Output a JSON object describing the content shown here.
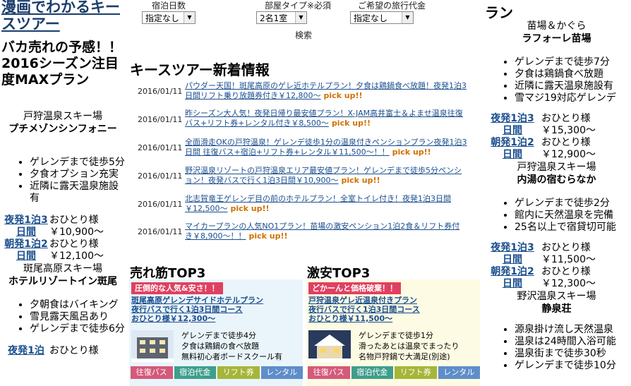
{
  "left": {
    "site_title": "漫画でわかるキースツアー",
    "feature_title": "バカ売れの予感！！2016シーズン注目度MAXプラン",
    "hotels": [
      {
        "area": "戸狩温泉スキー場",
        "name": "プチメゾンシンフォニー",
        "features": [
          "ゲレンデまで徒歩5分",
          "夕食オプション充実",
          "近隣に露天温泉施設有"
        ],
        "prices": [
          {
            "plan": "夜発1泊3日間",
            "who": "おひとり様",
            "amount": "￥10,900～"
          },
          {
            "plan": "朝発1泊2日間",
            "who": "おひとり様",
            "amount": "￥12,100～"
          }
        ]
      },
      {
        "area": "斑尾高原スキー場",
        "name": "ホテルリゾートイン斑尾",
        "features": [
          "夕朝食はバイキング",
          "雪見露天風呂あり",
          "ゲレンデまで徒歩6分"
        ],
        "prices": [
          {
            "plan": "夜発1泊",
            "who": "おひとり様",
            "amount": ""
          }
        ]
      }
    ]
  },
  "search": {
    "nights_label": "宿泊日数",
    "nights_value": "指定なし",
    "room_label": "部屋タイプ※必須",
    "room_value": "2名1室",
    "budget_label": "ご希望の旅行代金",
    "budget_value": "指定なし",
    "button": "検索"
  },
  "news": {
    "title": "キースツアー新着情報",
    "pick_label": "pick up!!",
    "items": [
      {
        "date": "2016/01/11",
        "text": "パウダー天国！斑尾高原のゲレ近ホテルプラン！夕食は鶏鍋食べ放題！夜発1泊3日間リフト乗り放題券付き￥12,800～"
      },
      {
        "date": "2016/01/11",
        "text": "昨シーズン大人気！夜発日帰り最安値プラン！X-JAM高井富士＆よませ温泉往復バス+リフト券+レンタル付き￥8,500～"
      },
      {
        "date": "2016/01/11",
        "text": "全面滑走OKの戸狩温泉！ゲレンデ徒歩1分の温泉付きペンションプラン夜発1泊3日間 往復バス+宿泊+リフト券+レンタル￥11,500～！！"
      },
      {
        "date": "2016/01/11",
        "text": "野沢温泉リゾートの戸狩温泉エリア最安値プラン！ゲレンデまで徒歩5分ペンション！夜発バスで行く1泊3日間￥10,900～"
      },
      {
        "date": "2016/01/11",
        "text": "北志賀竜王ゲレンデ目の前のホテルプラン！全室トイレ付き！夜発1泊3日間￥12,500～"
      },
      {
        "date": "2016/01/11",
        "text": "マイカープランの人気NO1プラン！苗場の激安ペンション1泊2食＆リフト券付き￥8,900～！！"
      }
    ]
  },
  "best": {
    "title": "売れ筋TOP3",
    "ribbon": "圧倒的な人気&安さ！！",
    "plan_lines": [
      "斑尾高原ゲレンデサイドホテルプラン",
      "夜行バスで行く1泊3日間コース",
      "おひとり様￥12,300～"
    ],
    "features": [
      "ゲレンデまで徒歩4分",
      "夕食は鶏鍋の食べ放題",
      "無料初心者ボードスクール有"
    ],
    "tags": [
      "往復バス",
      "宿泊代金",
      "リフト券",
      "レンタル"
    ]
  },
  "cheap": {
    "title": "激安TOP3",
    "ribbon": "どかーんと価格破棄！！",
    "plan_lines": [
      "戸狩温泉ゲレ近温泉付きプラン",
      "夜行バスで行く1泊3日間コース",
      "おひとり様￥11,500～"
    ],
    "features": [
      "ゲレンデまで徒歩1分",
      "滑ったあとは温泉でまったり",
      "名物戸狩鍋で大満足(別途)"
    ],
    "tags": [
      "往復バス",
      "宿泊代金",
      "リフト券",
      "レンタル"
    ]
  },
  "right": {
    "top_fragment": "ラン",
    "hotels": [
      {
        "area": "苗場＆かぐら",
        "name": "ラフォーレ苗場",
        "features": [
          "ゲレンデまで徒歩7分",
          "夕食は鶏鍋食べ放題",
          "近隣に露天温泉施設有",
          "雪マジ19対応ゲレンデ"
        ],
        "prices": [
          {
            "plan": "夜発1泊3日間",
            "who": "おひとり様",
            "amount": "￥15,300～"
          },
          {
            "plan": "朝発1泊2日間",
            "who": "おひとり様",
            "amount": "￥12,900～"
          }
        ]
      },
      {
        "area": "戸狩温泉スキー場",
        "name": "内湯の宿むらなか",
        "features": [
          "ゲレンデまで徒歩2分",
          "館内に天然温泉を完備",
          "25名以上で宿貸切可能"
        ],
        "prices": [
          {
            "plan": "夜発1泊3日間",
            "who": "おひとり様",
            "amount": "￥11,500～"
          },
          {
            "plan": "朝発1泊2日間",
            "who": "おひとり様",
            "amount": "￥12,300～"
          }
        ]
      },
      {
        "area": "野沢温泉スキー場",
        "name": "静泉荘",
        "features": [
          "源泉掛け流し天然温泉",
          "温泉は24時間入浴可能",
          "温泉街まで徒歩30秒",
          "ゲレンデまで徒歩10分"
        ],
        "prices": []
      }
    ]
  },
  "colors": {
    "link": "#1a4e8e",
    "pick": "#d07000",
    "ribbon": "#e04060",
    "best_panel": "#eaf5fb",
    "cheap_panel": "#fdfbe3",
    "tag_bus": "#d45a7a",
    "tag_stay": "#3f9e8c",
    "tag_lift": "#a6b63a",
    "tag_rental": "#5e8ec9"
  }
}
